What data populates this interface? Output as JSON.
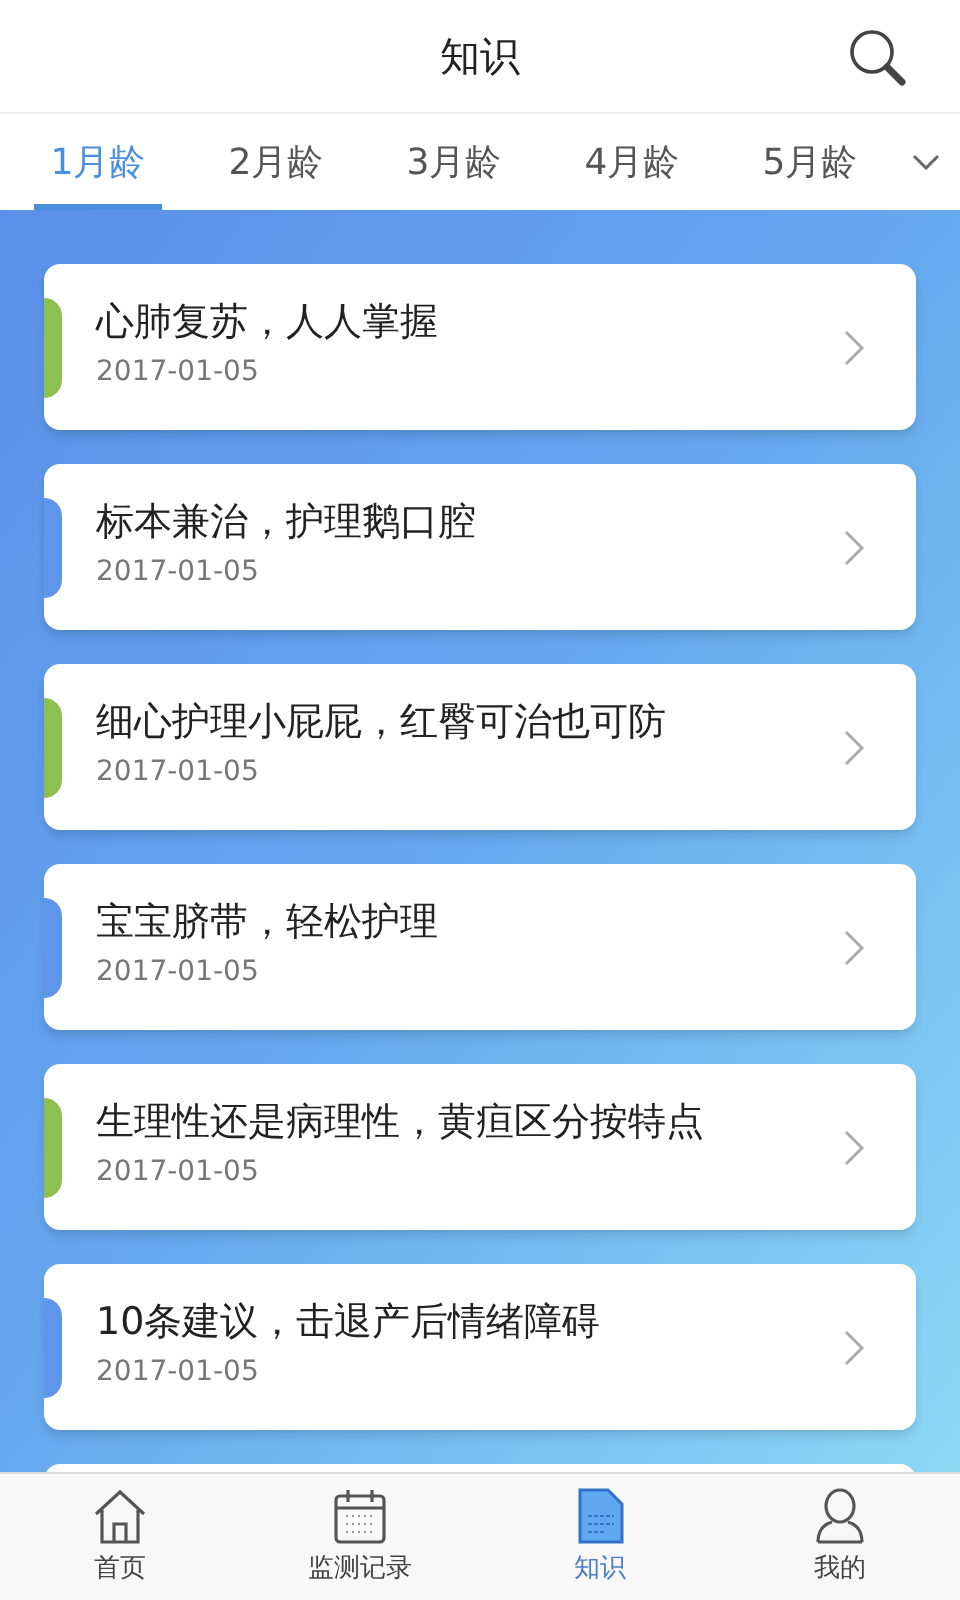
{
  "header": {
    "title": "知识"
  },
  "tabs": [
    {
      "label": "1月龄",
      "selected": true
    },
    {
      "label": "2月龄",
      "selected": false
    },
    {
      "label": "3月龄",
      "selected": false
    },
    {
      "label": "4月龄",
      "selected": false
    },
    {
      "label": "5月龄",
      "selected": false
    }
  ],
  "articles": [
    {
      "title": "心肺复苏，人人掌握",
      "date": "2017-01-05",
      "color": "#8cc152"
    },
    {
      "title": "标本兼治，护理鹅口腔",
      "date": "2017-01-05",
      "color": "#5f95ea"
    },
    {
      "title": "细心护理小屁屁，红臀可治也可防",
      "date": "2017-01-05",
      "color": "#8cc152"
    },
    {
      "title": "宝宝脐带，轻松护理",
      "date": "2017-01-05",
      "color": "#5f95ea"
    },
    {
      "title": "生理性还是病理性，黄疸区分按特点",
      "date": "2017-01-05",
      "color": "#8cc152"
    },
    {
      "title": "10条建议，击退产后情绪障碍",
      "date": "2017-01-05",
      "color": "#5f95ea"
    }
  ],
  "nav": [
    {
      "label": "首页",
      "kind": "home",
      "selected": false
    },
    {
      "label": "监测记录",
      "kind": "calendar",
      "selected": false
    },
    {
      "label": "知识",
      "kind": "document",
      "selected": true
    },
    {
      "label": "我的",
      "kind": "person",
      "selected": false
    }
  ]
}
